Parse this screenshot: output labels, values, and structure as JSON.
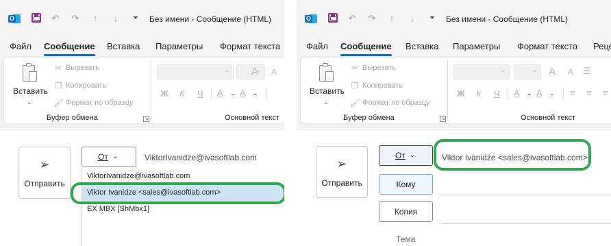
{
  "window": {
    "title": "Без имени  -  Сообщение (HTML)",
    "icons": [
      "outlook-icon",
      "save-icon",
      "undo-icon",
      "redo-icon",
      "arrow-up-icon",
      "arrow-down-icon",
      "customize-qat-icon"
    ]
  },
  "tabs_left": [
    "Файл",
    "Сообщение",
    "Вставка",
    "Параметры",
    "Формат текста"
  ],
  "tabs_right": [
    "Файл",
    "Сообщение",
    "Вставка",
    "Параметры",
    "Формат текста",
    "Реце"
  ],
  "active_tab": "Сообщение",
  "ribbon": {
    "paste_label": "Вставить",
    "cut": "Вырезать",
    "copy": "Копировать",
    "format_painter": "Формат по образцу",
    "clipboard_group": "Буфер обмена",
    "text_group": "Основной текст",
    "bold": "Ж",
    "italic": "К",
    "underline": "Ч",
    "grow_font": "A",
    "shrink_font": "A",
    "highlight": "A",
    "font_color": "A"
  },
  "compose": {
    "send_label": "Отправить",
    "from_label": "От",
    "to_label": "Кому",
    "cc_label": "Копия",
    "subject_label": "Тема"
  },
  "left": {
    "from_value": "ViktorIvanidze@ivasoftlab.com",
    "menu_items": [
      "ViktorIvanidze@ivasoftlab.com",
      "Viktor Ivanidze <sales@ivasoftlab.com>",
      "EX MBX [ShMbx1]"
    ]
  },
  "right": {
    "from_value": "Viktor Ivanidze <sales@ivasoftlab.com>"
  },
  "colors": {
    "highlight_green": "#2fa84f",
    "accent_blue": "#0f6cbd",
    "selected_row": "#cde4f7"
  }
}
